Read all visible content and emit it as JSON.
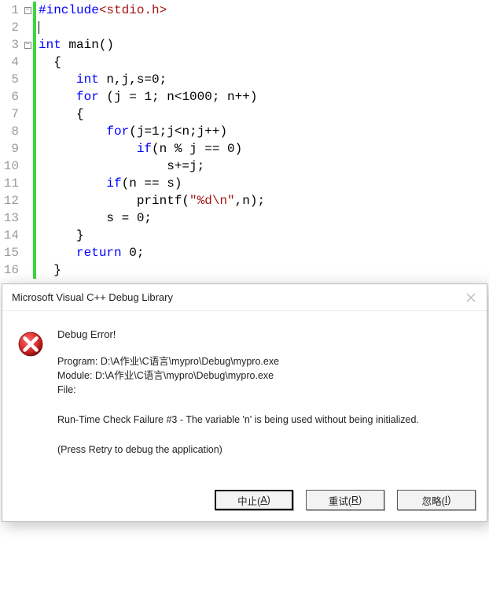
{
  "editor": {
    "lines": [
      {
        "n": "1",
        "fold": "minus",
        "tokens": [
          {
            "t": "#include",
            "c": "tok-pp"
          },
          {
            "t": "<stdio.h>",
            "c": "tok-inc"
          }
        ]
      },
      {
        "n": "2",
        "fold": "",
        "tokens": [
          {
            "t": "",
            "c": ""
          }
        ],
        "caret": true
      },
      {
        "n": "3",
        "fold": "minus",
        "tokens": [
          {
            "t": "int",
            "c": "tok-kw"
          },
          {
            "t": " main()",
            "c": "tok-def"
          }
        ]
      },
      {
        "n": "4",
        "fold": "",
        "tokens": [
          {
            "t": "  {",
            "c": "tok-def"
          }
        ]
      },
      {
        "n": "5",
        "fold": "",
        "tokens": [
          {
            "t": "     ",
            "c": ""
          },
          {
            "t": "int",
            "c": "tok-kw"
          },
          {
            "t": " n,j,s=0;",
            "c": "tok-def"
          }
        ]
      },
      {
        "n": "6",
        "fold": "",
        "tokens": [
          {
            "t": "     ",
            "c": ""
          },
          {
            "t": "for",
            "c": "tok-kw"
          },
          {
            "t": " (j = 1; n<1000; n++)",
            "c": "tok-def"
          }
        ]
      },
      {
        "n": "7",
        "fold": "",
        "tokens": [
          {
            "t": "     {",
            "c": "tok-def"
          }
        ]
      },
      {
        "n": "8",
        "fold": "",
        "tokens": [
          {
            "t": "         ",
            "c": ""
          },
          {
            "t": "for",
            "c": "tok-kw"
          },
          {
            "t": "(j=1;j<n;j++)",
            "c": "tok-def"
          }
        ]
      },
      {
        "n": "9",
        "fold": "",
        "tokens": [
          {
            "t": "             ",
            "c": ""
          },
          {
            "t": "if",
            "c": "tok-kw"
          },
          {
            "t": "(n % j == 0)",
            "c": "tok-def"
          }
        ]
      },
      {
        "n": "10",
        "fold": "",
        "tokens": [
          {
            "t": "                 s+=j;",
            "c": "tok-def"
          }
        ]
      },
      {
        "n": "11",
        "fold": "",
        "tokens": [
          {
            "t": "         ",
            "c": ""
          },
          {
            "t": "if",
            "c": "tok-kw"
          },
          {
            "t": "(n == s)",
            "c": "tok-def"
          }
        ]
      },
      {
        "n": "12",
        "fold": "",
        "tokens": [
          {
            "t": "             printf(",
            "c": "tok-def"
          },
          {
            "t": "\"%d\\n\"",
            "c": "tok-str"
          },
          {
            "t": ",n);",
            "c": "tok-def"
          }
        ]
      },
      {
        "n": "13",
        "fold": "",
        "tokens": [
          {
            "t": "         s = 0;",
            "c": "tok-def"
          }
        ]
      },
      {
        "n": "14",
        "fold": "",
        "tokens": [
          {
            "t": "     }",
            "c": "tok-def"
          }
        ]
      },
      {
        "n": "15",
        "fold": "",
        "tokens": [
          {
            "t": "     ",
            "c": ""
          },
          {
            "t": "return",
            "c": "tok-kw"
          },
          {
            "t": " 0;",
            "c": "tok-def"
          }
        ]
      },
      {
        "n": "16",
        "fold": "",
        "tokens": [
          {
            "t": "  }",
            "c": "tok-def"
          }
        ]
      }
    ]
  },
  "dialog": {
    "title": "Microsoft Visual C++ Debug Library",
    "heading": "Debug Error!",
    "program_label": "Program: ",
    "program_path": "D:\\A作业\\C语言\\mypro\\Debug\\mypro.exe",
    "module_label": "Module: ",
    "module_path": "D:\\A作业\\C语言\\mypro\\Debug\\mypro.exe",
    "file_label": "File:",
    "error_text": "Run-Time Check Failure #3 - The variable 'n' is being used without being initialized.",
    "hint_text": "(Press Retry to debug the application)",
    "buttons": {
      "abort": {
        "text": "中止(",
        "key": "A",
        "suffix": ")"
      },
      "retry": {
        "text": "重试(",
        "key": "R",
        "suffix": ")"
      },
      "ignore": {
        "text": "忽略(",
        "key": "I",
        "suffix": ")"
      }
    }
  }
}
